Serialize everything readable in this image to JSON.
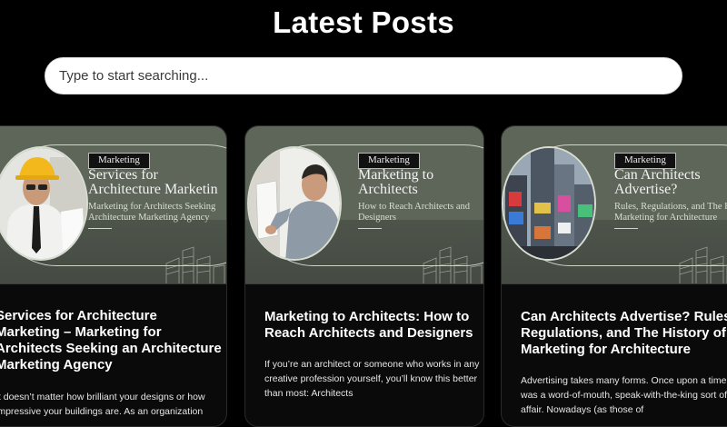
{
  "page": {
    "title": "Latest Posts"
  },
  "search": {
    "placeholder": "Type to start searching..."
  },
  "posts": [
    {
      "thumb_tag": "Marketing",
      "thumb_title_line1": "Services for",
      "thumb_title_line2": "Architecture Marketin",
      "thumb_sub_line1": "Marketing for Architects Seeking",
      "thumb_sub_line2": "Architecture Marketing Agency",
      "title": "Services for Architecture Marketing – Marketing for Architects Seeking an Architecture Marketing Agency",
      "excerpt": "It doesn’t matter how brilliant your designs or how impressive your buildings are. As an organization"
    },
    {
      "thumb_tag": "Marketing",
      "thumb_title_line1": "Marketing to",
      "thumb_title_line2": "Architects",
      "thumb_sub_line1": "How to Reach Architects and",
      "thumb_sub_line2": "Designers",
      "title": "Marketing to Architects: How to Reach Architects and Designers",
      "excerpt": "If you’re an architect or someone who works in any creative profession yourself, you’ll know this better than most: Architects"
    },
    {
      "thumb_tag": "Marketing",
      "thumb_title_line1": "Can Architects",
      "thumb_title_line2": "Advertise?",
      "thumb_sub_line1": "Rules, Regulations, and The History of",
      "thumb_sub_line2": "Marketing for Architecture",
      "title": "Can Architects Advertise? Rules, Regulations, and The History of Marketing for Architecture",
      "excerpt": "Advertising takes many forms. Once upon a time, it was a word-of-mouth, speak-with-the-king sort of affair. Nowadays (as those of"
    }
  ]
}
